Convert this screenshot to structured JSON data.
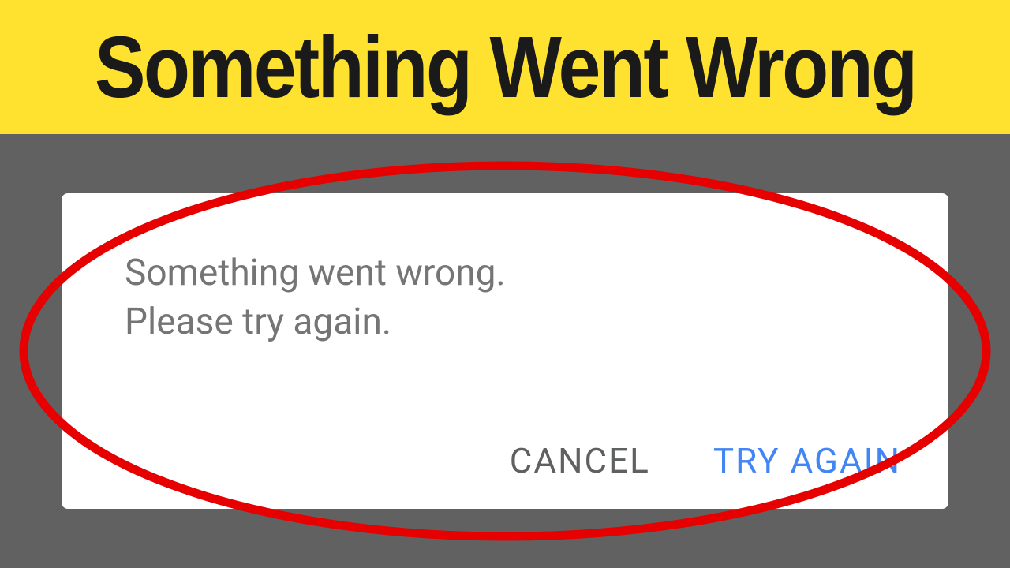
{
  "banner": {
    "title": "Something Went Wrong"
  },
  "dialog": {
    "message_line1": "Something went wrong.",
    "message_line2": "Please try again.",
    "cancel_label": "CANCEL",
    "try_again_label": "TRY AGAIN"
  },
  "colors": {
    "banner_bg": "#ffe12f",
    "gray_bg": "#616161",
    "ellipse": "#e60000",
    "cancel_text": "#5f6061",
    "try_text": "#4285f4"
  }
}
